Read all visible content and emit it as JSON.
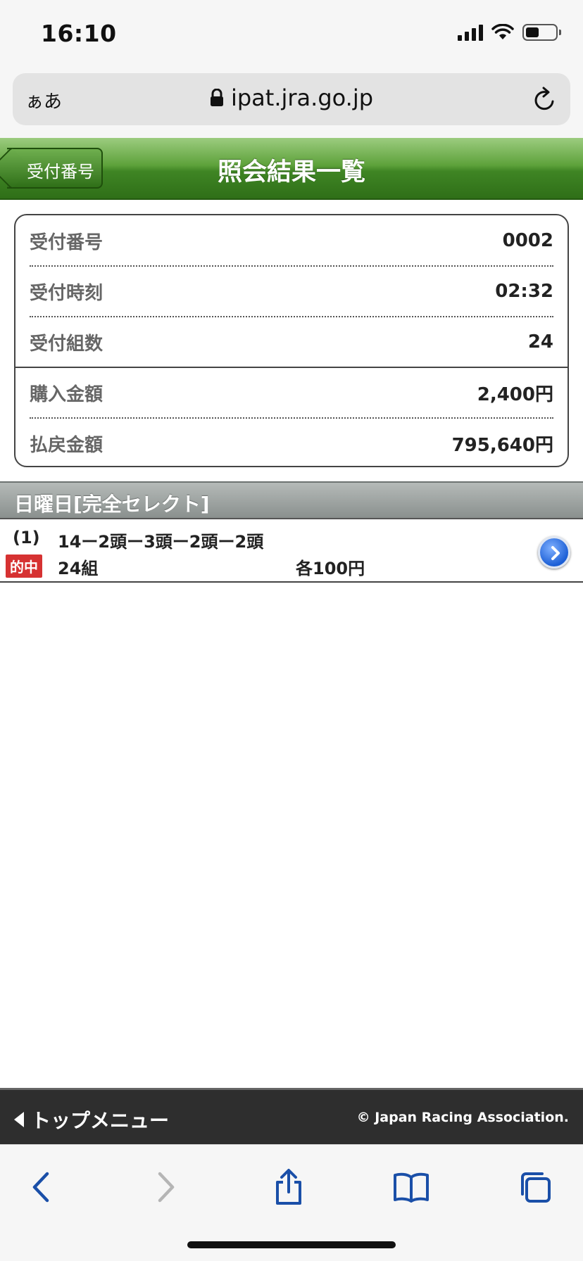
{
  "status_bar": {
    "time": "16:10"
  },
  "browser": {
    "text_size_label": "ぁあ",
    "url": "ipat.jra.go.jp"
  },
  "header": {
    "back_label": "受付番号",
    "title": "照会結果一覧"
  },
  "receipt_info": [
    {
      "label": "受付番号",
      "value": "0002"
    },
    {
      "label": "受付時刻",
      "value": "02:32"
    },
    {
      "label": "受付組数",
      "value": "24"
    },
    {
      "label": "購入金額",
      "value": "2,400円"
    },
    {
      "label": "払戻金額",
      "value": "795,640円"
    }
  ],
  "section": {
    "title": "日曜日[完全セレクト]"
  },
  "bet": {
    "index": "(1)",
    "combination": "14ー2頭ー3頭ー2頭ー2頭",
    "hit_badge": "的中",
    "count": "24組",
    "unit_amount": "各100円"
  },
  "footer": {
    "top_menu_label": "トップメニュー",
    "copyright": "© Japan Racing Association."
  },
  "colors": {
    "header_green": "#3f8524",
    "hit_red": "#d63232",
    "safari_blue": "#1a4fa8",
    "footer_dark": "#2e2e2e"
  },
  "icons": {
    "lock": "lock-icon",
    "reload": "reload-icon",
    "detail": "chevron-right-circle-icon",
    "back_triangle": "triangle-left-icon",
    "nav_back": "chevron-left-icon",
    "nav_forward": "chevron-right-icon",
    "share": "share-icon",
    "bookmarks": "book-icon",
    "tabs": "tabs-icon"
  }
}
